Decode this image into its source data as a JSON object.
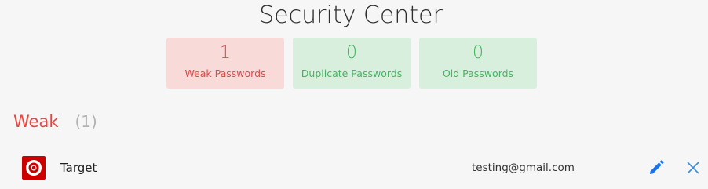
{
  "header": {
    "title": "Security Center"
  },
  "stats": [
    {
      "count": "1",
      "label": "Weak Passwords"
    },
    {
      "count": "0",
      "label": "Duplicate Passwords"
    },
    {
      "count": "0",
      "label": "Old Passwords"
    }
  ],
  "section": {
    "title": "Weak",
    "count": "(1)"
  },
  "entries": [
    {
      "site": "Target",
      "email": "testing@gmail.com",
      "logo_icon": "target-logo-icon",
      "actions": [
        "pencil-icon",
        "close-icon"
      ]
    }
  ],
  "colors": {
    "weak_bg": "#f8dad9",
    "weak_text": "#e04a45",
    "ok_bg": "#d9efde",
    "ok_text": "#40b75a",
    "accent_blue": "#1a73e8",
    "section_red": "#e84540"
  }
}
